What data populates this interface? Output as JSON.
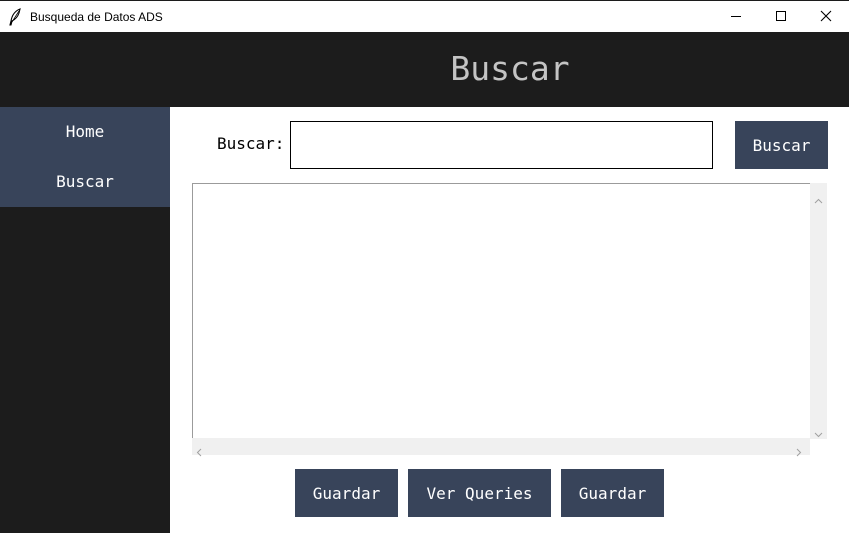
{
  "window": {
    "title": "Busqueda de Datos ADS"
  },
  "header": {
    "heading": "Buscar"
  },
  "sidebar": {
    "items": [
      {
        "label": "Home"
      },
      {
        "label": "Buscar"
      }
    ]
  },
  "search": {
    "label": "Buscar:",
    "value": "",
    "button_label": "Buscar"
  },
  "results": {
    "text": ""
  },
  "actions": {
    "guardar_1": "Guardar",
    "ver_queries": "Ver Queries",
    "guardar_2": "Guardar"
  },
  "icons": {
    "app": "feather-icon",
    "minimize": "minimize-icon",
    "maximize": "maximize-icon",
    "close": "close-icon"
  },
  "colors": {
    "dark_bg": "#1c1c1c",
    "accent": "#38445a",
    "heading_text": "#c4c4c4",
    "scrollbar": "#f0f0f0"
  }
}
